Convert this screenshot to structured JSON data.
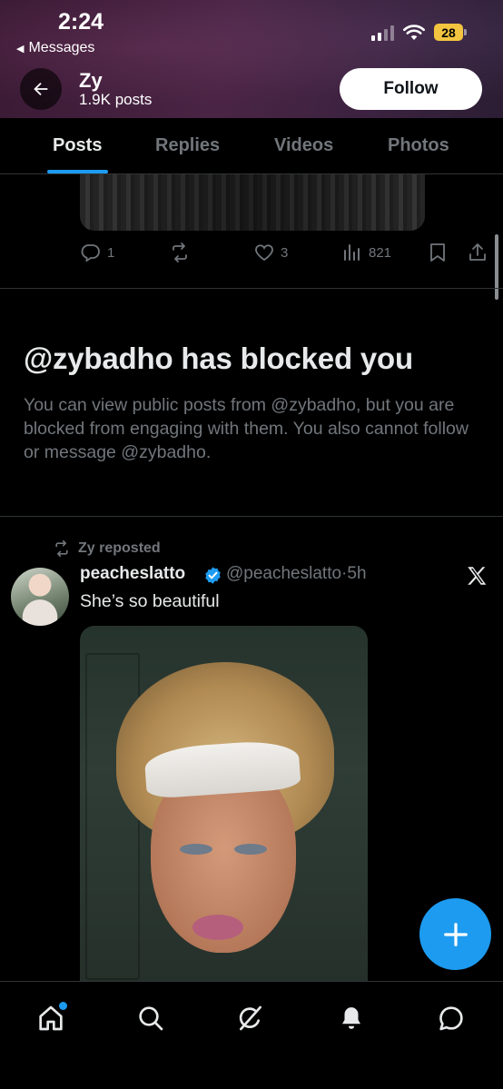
{
  "status_bar": {
    "time": "2:24",
    "back_app_label": "Messages",
    "battery_level": "28",
    "battery_color": "#f3c43f"
  },
  "header": {
    "profile_name": "Zy",
    "post_count": "1.9K posts",
    "follow_label": "Follow",
    "back_icon": "arrow-left-icon"
  },
  "tabs": [
    {
      "label": "Posts",
      "active": true
    },
    {
      "label": "Replies",
      "active": false
    },
    {
      "label": "Videos",
      "active": false
    },
    {
      "label": "Photos",
      "active": false
    }
  ],
  "previous_post": {
    "replies": "1",
    "reposts": "",
    "likes": "3",
    "views": "821"
  },
  "blocked_notice": {
    "title": "@zybadho has blocked you",
    "body": "You can view public posts from @zybadho, but you are blocked from engaging with them. You also cannot follow or message @zybadho."
  },
  "repost": {
    "repost_label": "Zy reposted",
    "author_name": "peacheslatto",
    "verified": true,
    "handle": "@peacheslatto",
    "separator": "·",
    "time": "5h",
    "text": "She’s so beautiful"
  },
  "fab": {
    "icon": "plus-icon"
  },
  "bottom_nav": [
    {
      "icon": "home-icon",
      "active": true,
      "has_dot": true
    },
    {
      "icon": "search-icon"
    },
    {
      "icon": "grok-icon"
    },
    {
      "icon": "bell-icon"
    },
    {
      "icon": "messages-icon"
    }
  ],
  "colors": {
    "accent": "#1d9bf0",
    "text_primary": "#e7e9ea",
    "text_secondary": "#71767b",
    "background": "#000000",
    "divider": "#2f3336"
  }
}
